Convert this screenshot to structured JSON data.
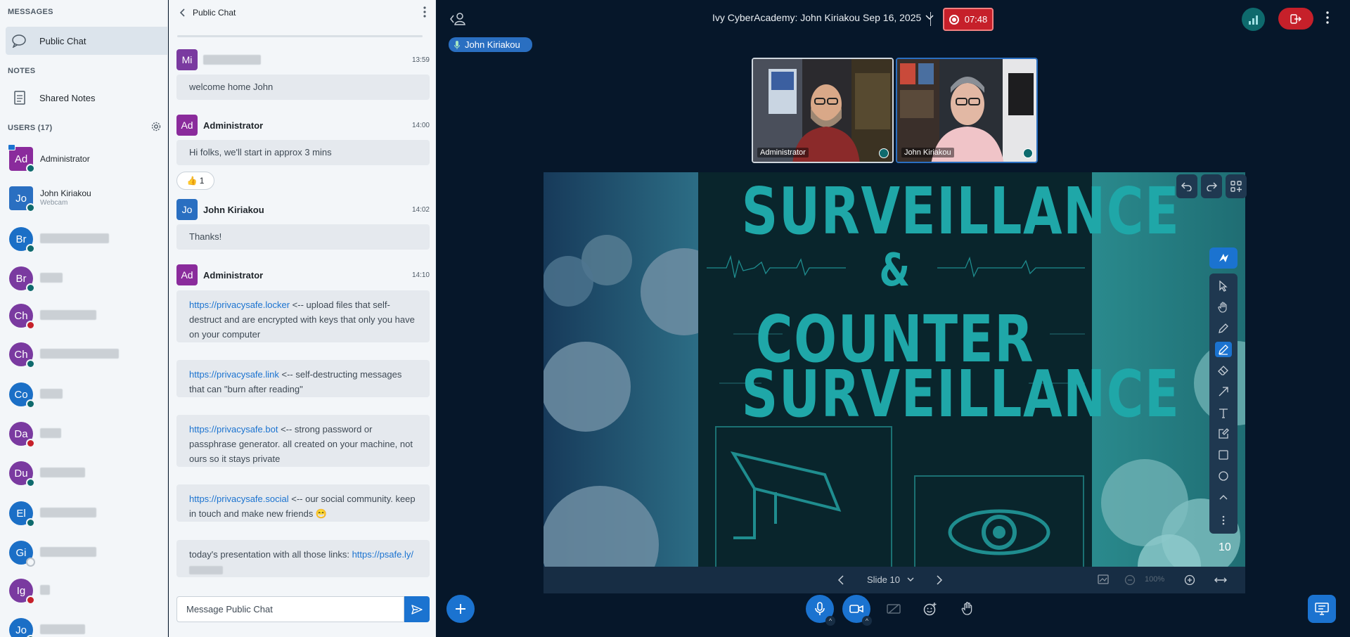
{
  "sidebar": {
    "messages_title": "MESSAGES",
    "public_chat_label": "Public Chat",
    "notes_title": "NOTES",
    "shared_notes_label": "Shared Notes",
    "users_title": "USERS (17)",
    "users": [
      {
        "initials": "Ad",
        "name": "Administrator",
        "sub": "",
        "color": "#8a2b9c",
        "mic": "#0e6a6d"
      },
      {
        "initials": "Jo",
        "name": "John Kiriakou",
        "sub": "Webcam",
        "color": "#2a6fc1",
        "mic": "#0e6a6d"
      },
      {
        "initials": "Br",
        "name": "",
        "sub": "",
        "color": "#1b6fc6",
        "mic": "#0e6a6d"
      },
      {
        "initials": "Br",
        "name": "",
        "sub": "",
        "color": "#7a3aa0",
        "mic": "#0e6a6d"
      },
      {
        "initials": "Ch",
        "name": "",
        "sub": "",
        "color": "#7a3aa0",
        "mic": "#c6202a"
      },
      {
        "initials": "Ch",
        "name": "",
        "sub": "",
        "color": "#7a3aa0",
        "mic": "#0e6a6d"
      },
      {
        "initials": "Co",
        "name": "",
        "sub": "",
        "color": "#1b6fc6",
        "mic": "#0e6a6d"
      },
      {
        "initials": "Da",
        "name": "",
        "sub": "",
        "color": "#7a3aa0",
        "mic": "#c6202a"
      },
      {
        "initials": "Du",
        "name": "",
        "sub": "",
        "color": "#7a3aa0",
        "mic": "#0e6a6d"
      },
      {
        "initials": "El",
        "name": "",
        "sub": "",
        "color": "#1b6fc6",
        "mic": "#0e6a6d"
      },
      {
        "initials": "Gi",
        "name": "",
        "sub": "",
        "color": "#1b6fc6",
        "mic": "#f3f6f9"
      },
      {
        "initials": "Ig",
        "name": "",
        "sub": "",
        "color": "#7a3aa0",
        "mic": "#c6202a"
      },
      {
        "initials": "Jo",
        "name": "",
        "sub": "",
        "color": "#1b6fc6",
        "mic": "#0e6a6d"
      }
    ]
  },
  "chat": {
    "header_title": "Public Chat",
    "messages": [
      {
        "initials": "Mi",
        "name": "",
        "time": "13:59",
        "color": "#7a3aa0",
        "text": "welcome home John"
      },
      {
        "initials": "Ad",
        "name": "Administrator",
        "time": "14:00",
        "color": "#8a2b9c",
        "text": "Hi folks, we'll start in approx 3 mins"
      },
      {
        "initials": "Jo",
        "name": "John Kiriakou",
        "time": "14:02",
        "color": "#2a6fc1",
        "text": "Thanks!"
      },
      {
        "initials": "Ad",
        "name": "Administrator",
        "time": "14:10",
        "color": "#8a2b9c",
        "text": ""
      }
    ],
    "reaction": "👍 1",
    "links": [
      {
        "url": "https://privacysafe.locker",
        "desc": " <-- upload files that self-destruct and are encrypted with keys that only you have on your computer"
      },
      {
        "url": "https://privacysafe.link",
        "desc": " <-- self-destructing messages that can \"burn after reading\""
      },
      {
        "url": "https://privacysafe.bot",
        "desc": " <-- strong password or passphrase generator. all created on your machine, not ours so it stays private"
      },
      {
        "url": "https://privacysafe.social",
        "desc": " <-- our social community. keep in touch and make new friends 😁"
      }
    ],
    "last_text": "today's presentation with all those links: ",
    "last_link": "https://psafe.ly/",
    "input_placeholder": "Message Public Chat"
  },
  "main": {
    "talking": "John Kiriakou",
    "meeting_title": "Ivy CyberAcademy: John Kiriakou Sep 16, 2025",
    "record_time": "07:48",
    "videos": [
      {
        "name": "Administrator"
      },
      {
        "name": "John Kiriakou"
      }
    ],
    "slide": {
      "line1": "SURVEILLANCE",
      "line2": "&",
      "line3": "COUNTER",
      "line4": "SURVEILLANCE",
      "number": "10"
    },
    "slide_selector": "Slide 10",
    "zoom": "100%"
  },
  "colors": {
    "accent": "#1b73d0",
    "record": "#c6202a",
    "slide_text": "#1fa7a8"
  }
}
